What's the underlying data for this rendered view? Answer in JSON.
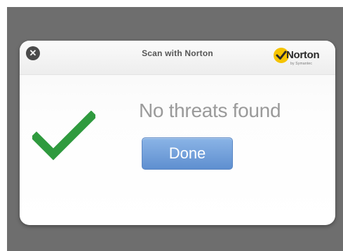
{
  "dialog": {
    "title": "Scan with Norton",
    "close_icon": "close-circle-icon",
    "logo": {
      "wordmark": "Norton",
      "sublabel": "by Symantec",
      "check_color": "#f5c300"
    },
    "status_icon": "checkmark-icon",
    "status_color": "#2f9a3e",
    "message": "No threats found",
    "done_label": "Done",
    "accent": "#6f9edb"
  }
}
